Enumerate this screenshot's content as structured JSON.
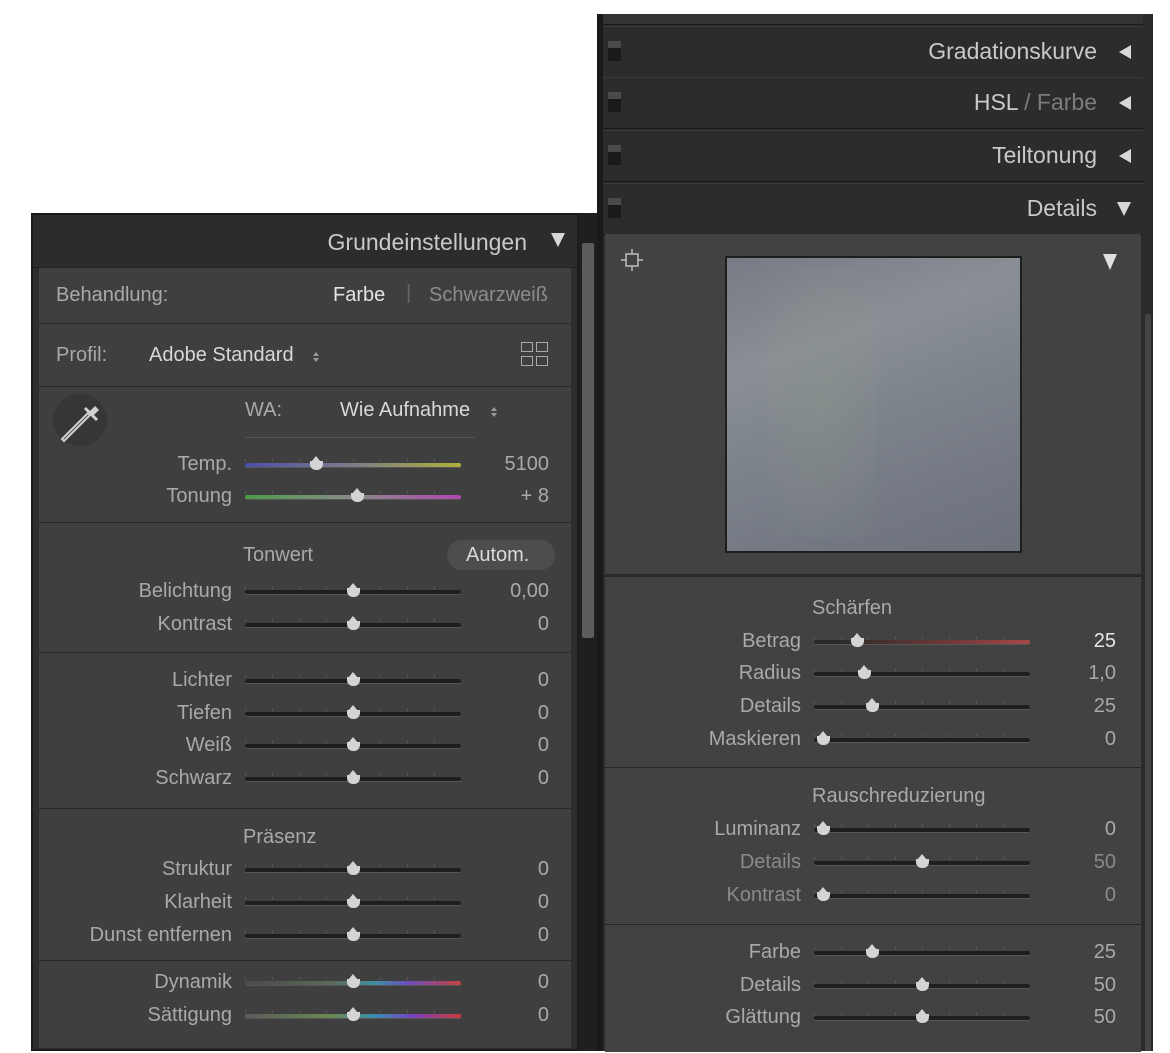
{
  "basic": {
    "header": "Grundeinstellungen",
    "treatment_label": "Behandlung:",
    "treatment_color": "Farbe",
    "treatment_divider": "|",
    "treatment_bw": "Schwarzweiß",
    "profile_label": "Profil:",
    "profile_value": "Adobe Standard",
    "wb_label": "WA:",
    "wb_value": "Wie Aufnahme",
    "tone_title": "Tonwert",
    "auto_button": "Autom.",
    "presence_title": "Präsenz",
    "sliders": [
      {
        "label": "Temp.",
        "value": "5100",
        "pos": 0.33,
        "track": "temp"
      },
      {
        "label": "Tonung",
        "value": "+ 8",
        "pos": 0.52,
        "track": "tint"
      },
      {
        "label": "Belichtung",
        "value": "0,00",
        "pos": 0.5,
        "track": "plain"
      },
      {
        "label": "Kontrast",
        "value": "0",
        "pos": 0.5,
        "track": "plain"
      },
      {
        "label": "Lichter",
        "value": "0",
        "pos": 0.5,
        "track": "plain"
      },
      {
        "label": "Tiefen",
        "value": "0",
        "pos": 0.5,
        "track": "plain"
      },
      {
        "label": "Weiß",
        "value": "0",
        "pos": 0.5,
        "track": "plain"
      },
      {
        "label": "Schwarz",
        "value": "0",
        "pos": 0.5,
        "track": "plain"
      },
      {
        "label": "Struktur",
        "value": "0",
        "pos": 0.5,
        "track": "plain"
      },
      {
        "label": "Klarheit",
        "value": "0",
        "pos": 0.5,
        "track": "plain"
      },
      {
        "label": "Dunst entfernen",
        "value": "0",
        "pos": 0.5,
        "track": "plain"
      },
      {
        "label": "Dynamik",
        "value": "0",
        "pos": 0.5,
        "track": "vib"
      },
      {
        "label": "Sättigung",
        "value": "0",
        "pos": 0.5,
        "track": "sat"
      }
    ]
  },
  "right": {
    "headers": [
      {
        "main": "Gradationskurve",
        "dim": "",
        "state": "collapsed"
      },
      {
        "main": "HSL",
        "dim": " / Farbe",
        "state": "collapsed"
      },
      {
        "main": "Teiltonung",
        "dim": "",
        "state": "collapsed"
      },
      {
        "main": "Details",
        "dim": "",
        "state": "expanded"
      }
    ],
    "sharpen_title": "Schärfen",
    "noise_title": "Rauschreduzierung",
    "sliders": [
      {
        "label": "Betrag",
        "value": "25",
        "pos": 0.2,
        "track": "red",
        "bright": true
      },
      {
        "label": "Radius",
        "value": "1,0",
        "pos": 0.23,
        "track": "plain"
      },
      {
        "label": "Details",
        "value": "25",
        "pos": 0.27,
        "track": "plain"
      },
      {
        "label": "Maskieren",
        "value": "0",
        "pos": 0.04,
        "track": "plain"
      },
      {
        "label": "Luminanz",
        "value": "0",
        "pos": 0.04,
        "track": "plain"
      },
      {
        "label": "Details",
        "value": "50",
        "pos": 0.5,
        "track": "plain",
        "dim": true
      },
      {
        "label": "Kontrast",
        "value": "0",
        "pos": 0.04,
        "track": "plain",
        "dim": true
      },
      {
        "label": "Farbe",
        "value": "25",
        "pos": 0.27,
        "track": "plain"
      },
      {
        "label": "Details",
        "value": "50",
        "pos": 0.5,
        "track": "plain"
      },
      {
        "label": "Glättung",
        "value": "50",
        "pos": 0.5,
        "track": "plain"
      }
    ]
  },
  "colors": {
    "panel_bg": "#3f3f3f",
    "header_bg": "#2c2c2c",
    "label": "#a9a9a9",
    "bright": "#e6e6e6"
  }
}
